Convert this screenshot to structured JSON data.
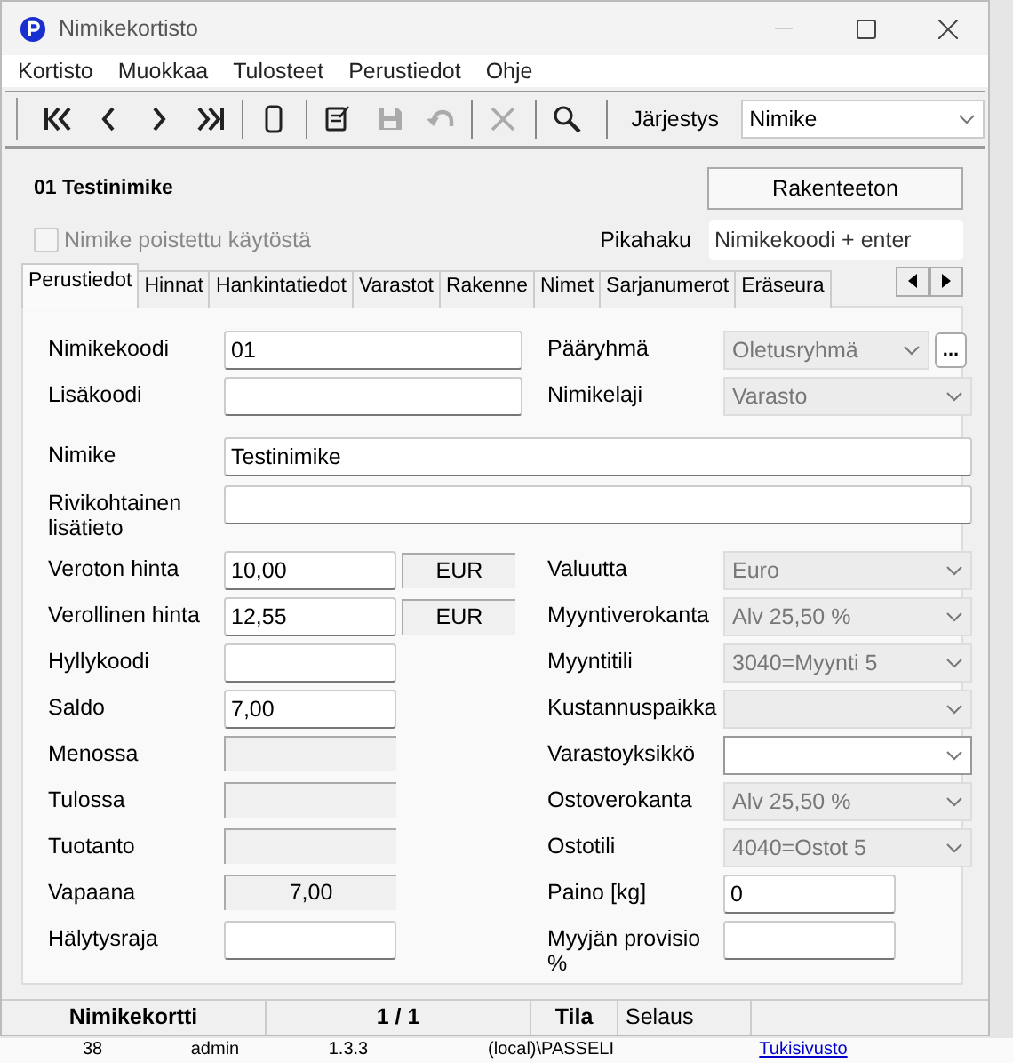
{
  "window": {
    "title": "Nimikekortisto"
  },
  "menu": [
    "Kortisto",
    "Muokkaa",
    "Tulosteet",
    "Perustiedot",
    "Ohje"
  ],
  "toolbar": {
    "buttons": [
      {
        "kind": "first",
        "disabled": false
      },
      {
        "kind": "prev",
        "disabled": false
      },
      {
        "kind": "next",
        "disabled": false
      },
      {
        "kind": "last",
        "disabled": false
      },
      {
        "kind": "separator"
      },
      {
        "kind": "new",
        "disabled": false
      },
      {
        "kind": "separator"
      },
      {
        "kind": "edit",
        "disabled": false
      },
      {
        "kind": "save",
        "disabled": true
      },
      {
        "kind": "undo",
        "disabled": true
      },
      {
        "kind": "separator"
      },
      {
        "kind": "delete",
        "disabled": true
      },
      {
        "kind": "separator"
      },
      {
        "kind": "search",
        "disabled": false
      }
    ],
    "order_label": "Järjestys",
    "order_value": "Nimike"
  },
  "header": {
    "item": "01  Testinimike",
    "structure_button": "Rakenteeton",
    "removed_checkbox": {
      "label": "Nimike poistettu käytöstä",
      "checked": false,
      "disabled": true
    },
    "quick_search_label": "Pikahaku",
    "quick_search": {
      "placeholder": "Nimikekoodi + enter"
    }
  },
  "tabs": [
    {
      "label": "Perustiedot",
      "selected": true
    },
    {
      "label": "Hinnat",
      "selected": false
    },
    {
      "label": "Hankintatiedot",
      "selected": false
    },
    {
      "label": "Varastot",
      "selected": false
    },
    {
      "label": "Rakenne",
      "selected": false
    },
    {
      "label": "Nimet",
      "selected": false
    },
    {
      "label": "Sarjanumerot",
      "selected": false
    },
    {
      "label": "Eräseura",
      "selected": false
    }
  ],
  "form": {
    "top_rows": [
      {
        "left": {
          "label": "Nimikekoodi",
          "kind": "text",
          "value": "01"
        },
        "right": {
          "label": "Pääryhmä",
          "kind": "select",
          "disabled": true,
          "value": "Oletusryhmä",
          "button": "..."
        }
      },
      {
        "left": {
          "label": "Lisäkoodi",
          "kind": "text"
        },
        "right": {
          "label": "Nimikelaji",
          "kind": "select",
          "disabled": true,
          "value": "Varasto"
        }
      }
    ],
    "full_rows": [
      {
        "label": "Nimike",
        "value": "Testinimike"
      },
      {
        "label": "Rivikohtainen lisätieto"
      }
    ],
    "rows": [
      {
        "left": {
          "label": "Veroton hinta",
          "kind": "text",
          "value": "10,00",
          "unit": "EUR"
        },
        "right": {
          "label": "Valuutta",
          "kind": "select",
          "disabled": true,
          "value": "Euro"
        }
      },
      {
        "left": {
          "label": "Verollinen hinta",
          "kind": "text",
          "value": "12,55",
          "unit": "EUR"
        },
        "right": {
          "label": "Myyntiverokanta",
          "kind": "select",
          "disabled": true,
          "value": "Alv 25,50 %"
        }
      },
      {
        "left": {
          "label": "Hyllykoodi",
          "kind": "text"
        },
        "right": {
          "label": "Myyntitili",
          "kind": "select",
          "disabled": true,
          "value": "3040=Myynti 5"
        }
      },
      {
        "left": {
          "label": "Saldo",
          "kind": "text",
          "value": "7,00"
        },
        "right": {
          "label": "Kustannuspaikka",
          "kind": "select",
          "disabled": true
        }
      },
      {
        "left": {
          "label": "Menossa",
          "kind": "readonly"
        },
        "right": {
          "label": "Varastoyksikkö",
          "kind": "select",
          "disabled": false
        }
      },
      {
        "left": {
          "label": "Tulossa",
          "kind": "readonly"
        },
        "right": {
          "label": "Ostoverokanta",
          "kind": "select",
          "disabled": true,
          "value": "Alv 25,50 %"
        }
      },
      {
        "left": {
          "label": "Tuotanto",
          "kind": "readonly"
        },
        "right": {
          "label": "Ostotili",
          "kind": "select",
          "disabled": true,
          "value": "4040=Ostot 5"
        }
      },
      {
        "left": {
          "label": "Vapaana",
          "kind": "readonly",
          "value": "7,00"
        },
        "right": {
          "label": "Paino [kg]",
          "kind": "text",
          "value": "0"
        }
      },
      {
        "left": {
          "label": "Hälytysraja",
          "kind": "text"
        },
        "right": {
          "label": "Myyjän provisio %",
          "kind": "text"
        }
      }
    ]
  },
  "status_bar": [
    {
      "text": "Nimikekortti",
      "kind": "heading"
    },
    {
      "text": "1 / 1",
      "kind": "heading"
    },
    {
      "text": "Tila",
      "kind": "heading"
    },
    {
      "text": "Selaus",
      "kind": "value"
    }
  ],
  "background_row": [
    "38",
    "admin",
    "1.3.3",
    "(local)\\PASSELI",
    "Tukisivusto"
  ]
}
